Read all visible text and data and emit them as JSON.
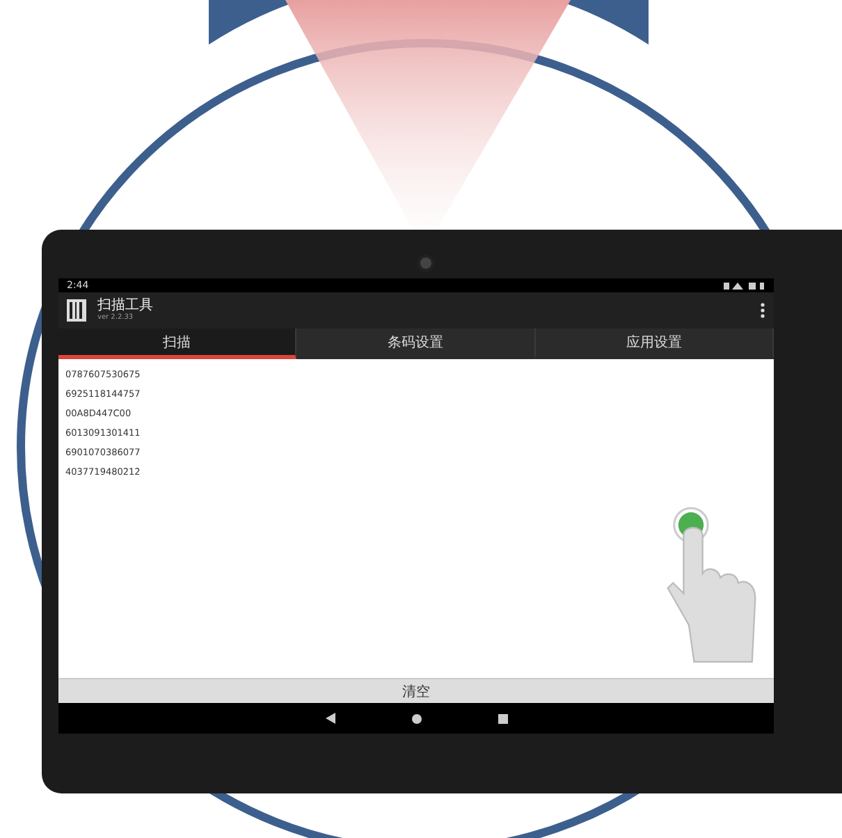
{
  "status_bar": {
    "time": "2:44"
  },
  "app_bar": {
    "title": "扫描工具",
    "version": "ver 2.2.33"
  },
  "tabs": [
    {
      "label": "扫描",
      "selected": true
    },
    {
      "label": "条码设置",
      "selected": false
    },
    {
      "label": "应用设置",
      "selected": false
    }
  ],
  "scan_results": [
    "0787607530675",
    "6925118144757",
    "00A8D447C00",
    "6013091301411",
    "6901070386077",
    "4037719480212"
  ],
  "clear_button": {
    "label": "清空"
  }
}
